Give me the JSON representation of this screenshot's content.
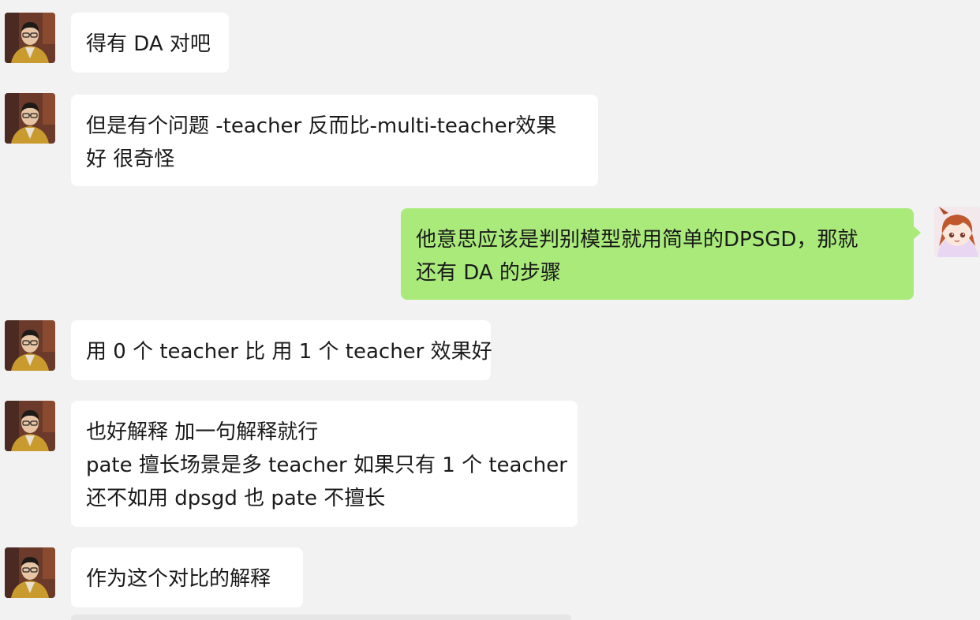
{
  "messages": [
    {
      "side": "left",
      "lines": [
        "得有 DA 对吧"
      ]
    },
    {
      "side": "left",
      "lines": [
        "但是有个问题 -teacher 反而比-multi-teacher效果",
        "好 很奇怪"
      ]
    },
    {
      "side": "right",
      "lines": [
        "他意思应该是判别模型就用简单的DPSGD，那就",
        "还有 DA 的步骤"
      ]
    },
    {
      "side": "left",
      "lines": [
        "用 0 个 teacher 比 用 1 个 teacher 效果好"
      ]
    },
    {
      "side": "left",
      "lines": [
        "也好解释 加一句解释就行",
        "pate 擅长场景是多 teacher 如果只有 1 个 teacher",
        "还不如用 dpsgd 也 pate 不擅长"
      ]
    },
    {
      "side": "left",
      "lines": [
        "作为这个对比的解释"
      ]
    }
  ],
  "colors": {
    "background": "#f2f2f2",
    "left_bubble": "#ffffff",
    "right_bubble": "#a9ea7a",
    "text": "#1a1a1a"
  },
  "icons": {
    "left_avatar": "male-with-glasses-avatar",
    "right_avatar": "anime-girl-avatar"
  }
}
